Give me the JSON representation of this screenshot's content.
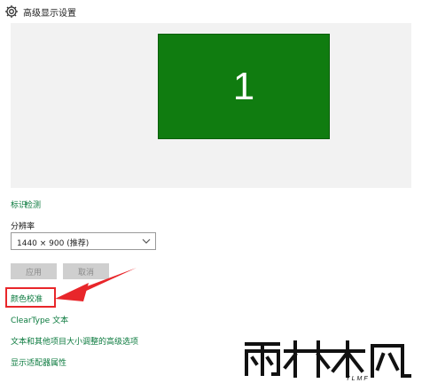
{
  "window": {
    "title": "高级显示设置"
  },
  "display_preview": {
    "monitor_number": "1",
    "monitor_color": "#107c10"
  },
  "links": {
    "identify": "标识",
    "detect": "检测"
  },
  "resolution": {
    "label": "分辨率",
    "value": "1440 × 900 (推荐)"
  },
  "buttons": {
    "apply": "应用",
    "cancel": "取消"
  },
  "related_settings": {
    "color_calibration": "颜色校准",
    "cleartype": "ClearType 文本",
    "text_sizing": "文本和其他项目大小调整的高级选项",
    "adapter_properties": "显示适配器属性"
  },
  "annotation": {
    "highlight_color": "#e8262a"
  },
  "watermark": {
    "brand": "雨林木风",
    "subtext": "YLMF"
  },
  "colors": {
    "link": "#0b7a3e",
    "accent": "#107c10"
  }
}
